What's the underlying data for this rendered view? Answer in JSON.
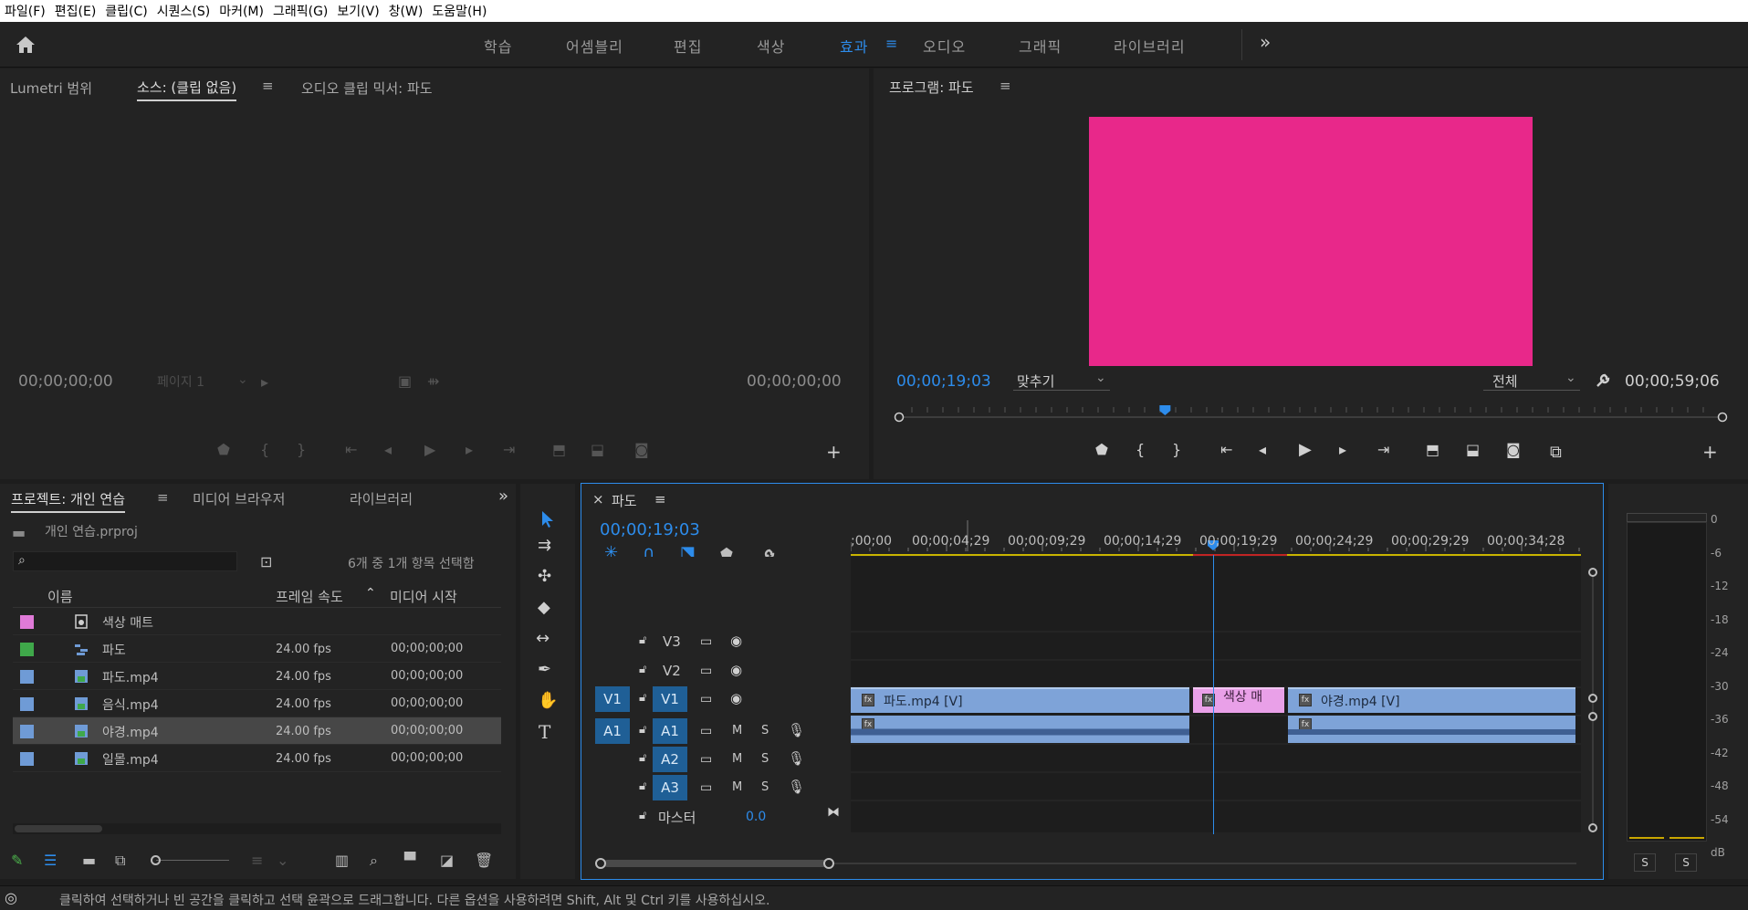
{
  "menu": [
    "파일(F)",
    "편집(E)",
    "클립(C)",
    "시퀀스(S)",
    "마커(M)",
    "그래픽(G)",
    "보기(V)",
    "창(W)",
    "도움말(H)"
  ],
  "workspaces": [
    "학습",
    "어셈블리",
    "편집",
    "색상",
    "효과",
    "오디오",
    "그래픽",
    "라이브러리"
  ],
  "active_workspace": "효과",
  "source_panel": {
    "tabs": [
      "Lumetri 범위",
      "소스: (클립 없음)",
      "오디오 클립 믹서: 파도"
    ],
    "timecode_left": "00;00;00;00",
    "timecode_right": "00;00;00;00",
    "page_label": "페이지 1"
  },
  "program_panel": {
    "title": "프로그램: 파도",
    "timecode_left": "00;00;19;03",
    "fit": "맞추기",
    "quality": "전체",
    "timecode_right": "00;00;59;06",
    "preview_color": "#e8288a",
    "playhead_fraction": 0.323
  },
  "project_panel": {
    "tabs": [
      "프로젝트: 개인 연습",
      "미디어 브라우저",
      "라이브러리"
    ],
    "project_file": "개인 연습.prproj",
    "selection_status": "6개 중 1개 항목 선택함",
    "columns": [
      "이름",
      "프레임 속도",
      "미디어 시작"
    ],
    "items": [
      {
        "name": "색상 매트",
        "fps": "",
        "start": "",
        "color": "#e07ad8",
        "icon": "color-matte-icon"
      },
      {
        "name": "파도",
        "fps": "24.00 fps",
        "start": "00;00;00;00",
        "color": "#3fa84a",
        "icon": "sequence-icon"
      },
      {
        "name": "파도.mp4",
        "fps": "24.00 fps",
        "start": "00;00;00;00",
        "color": "#6f9bd6",
        "icon": "video-file-icon"
      },
      {
        "name": "음식.mp4",
        "fps": "24.00 fps",
        "start": "00;00;00;00",
        "color": "#6f9bd6",
        "icon": "video-file-icon"
      },
      {
        "name": "야경.mp4",
        "fps": "24.00 fps",
        "start": "00;00;00;00",
        "color": "#6f9bd6",
        "icon": "video-file-icon",
        "selected": true
      },
      {
        "name": "일몰.mp4",
        "fps": "24.00 fps",
        "start": "00;00;00;00",
        "color": "#6f9bd6",
        "icon": "video-file-icon"
      }
    ]
  },
  "timeline": {
    "title": "파도",
    "timecode": "00;00;19;03",
    "ruler": [
      ";00;00",
      "00;00;04;29",
      "00;00;09;29",
      "00;00;14;29",
      "00;00;19;29",
      "00;00;24;29",
      "00;00;29;29",
      "00;00;34;28"
    ],
    "tracks": {
      "v3": "V3",
      "v2": "V2",
      "v1_src": "V1",
      "v1": "V1",
      "a1_src": "A1",
      "a1": "A1",
      "a2": "A2",
      "a3": "A3",
      "master": "마스터",
      "master_vol": "0.0",
      "m": "M",
      "s": "S"
    },
    "clips": {
      "clip1": "파도.mp4 [V]",
      "clip2": "색상 매",
      "clip3": "야경.mp4 [V]",
      "fx": "fx"
    }
  },
  "meter": {
    "labels": [
      "0",
      "-6",
      "-12",
      "-18",
      "-24",
      "-30",
      "-36",
      "-42",
      "-48",
      "-54",
      "dB"
    ],
    "solo": [
      "S",
      "S"
    ]
  },
  "status_bar": "클릭하여 선택하거나 빈 공간을 클릭하고 선택 윤곽으로 드래그합니다. 다른 옵션을 사용하려면 Shift, Alt 및 Ctrl 키를 사용하십시오."
}
